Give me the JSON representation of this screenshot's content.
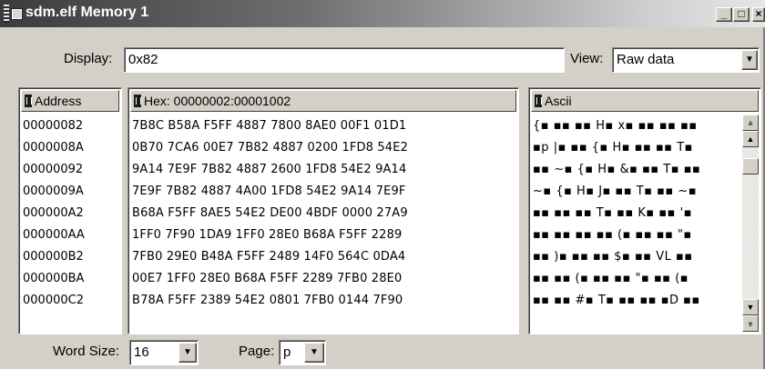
{
  "window": {
    "title": "sdm.elf Memory 1",
    "controls": {
      "minimize": "_",
      "maximize": "□",
      "close": "×"
    }
  },
  "display": {
    "label": "Display:",
    "value": "0x82"
  },
  "view": {
    "label": "View:",
    "value": "Raw data"
  },
  "address": {
    "header": "Address",
    "rows": [
      "00000082",
      "0000008A",
      "00000092",
      "0000009A",
      "000000A2",
      "000000AA",
      "000000B2",
      "000000BA",
      "000000C2"
    ]
  },
  "hex": {
    "header": "Hex: 00000002:00001002",
    "rows": [
      "7B8C B58A F5FF 4887 7800 8AE0 00F1 01D1",
      "0B70 7CA6 00E7 7B82 4887 0200 1FD8 54E2",
      "9A14 7E9F 7B82 4887 2600 1FD8 54E2 9A14",
      "7E9F 7B82 4887 4A00 1FD8 54E2 9A14 7E9F",
      "B68A F5FF 8AE5 54E2 DE00 4BDF 0000 27A9",
      "1FF0 7F90 1DA9 1FF0 28E0 B68A F5FF 2289",
      "7FB0 29E0 B48A F5FF 2489 14F0 564C 0DA4",
      "00E7 1FF0 28E0 B68A F5FF 2289 7FB0 28E0",
      "B78A F5FF 2389 54E2 0801 7FB0 0144 7F90"
    ]
  },
  "ascii": {
    "header": "Ascii",
    "rows": [
      "{▪ ▪▪ ▪▪ H▪ x▪ ▪▪ ▪▪ ▪▪",
      "▪p |▪ ▪▪ {▪ H▪ ▪▪ ▪▪ T▪",
      "▪▪ ~▪ {▪ H▪ &▪ ▪▪ T▪ ▪▪",
      "~▪ {▪ H▪ J▪ ▪▪ T▪ ▪▪ ~▪",
      "▪▪ ▪▪ ▪▪ T▪ ▪▪ K▪ ▪▪ '▪",
      "▪▪ ▪▪ ▪▪ ▪▪ (▪ ▪▪ ▪▪ \"▪",
      "▪▪ )▪ ▪▪ ▪▪ $▪ ▪▪ VL ▪▪",
      "▪▪ ▪▪ (▪ ▪▪ ▪▪ \"▪ ▪▪ (▪",
      "▪▪ ▪▪ #▪ T▪ ▪▪ ▪▪ ▪D ▪▪"
    ]
  },
  "word_size": {
    "label": "Word Size:",
    "value": "16"
  },
  "page": {
    "label": "Page:",
    "value": "p"
  },
  "icons": {
    "dropdown": "▼",
    "scroll_top": "⩓",
    "scroll_up": "▲",
    "scroll_down": "▼",
    "scroll_bottom": "⩔"
  }
}
